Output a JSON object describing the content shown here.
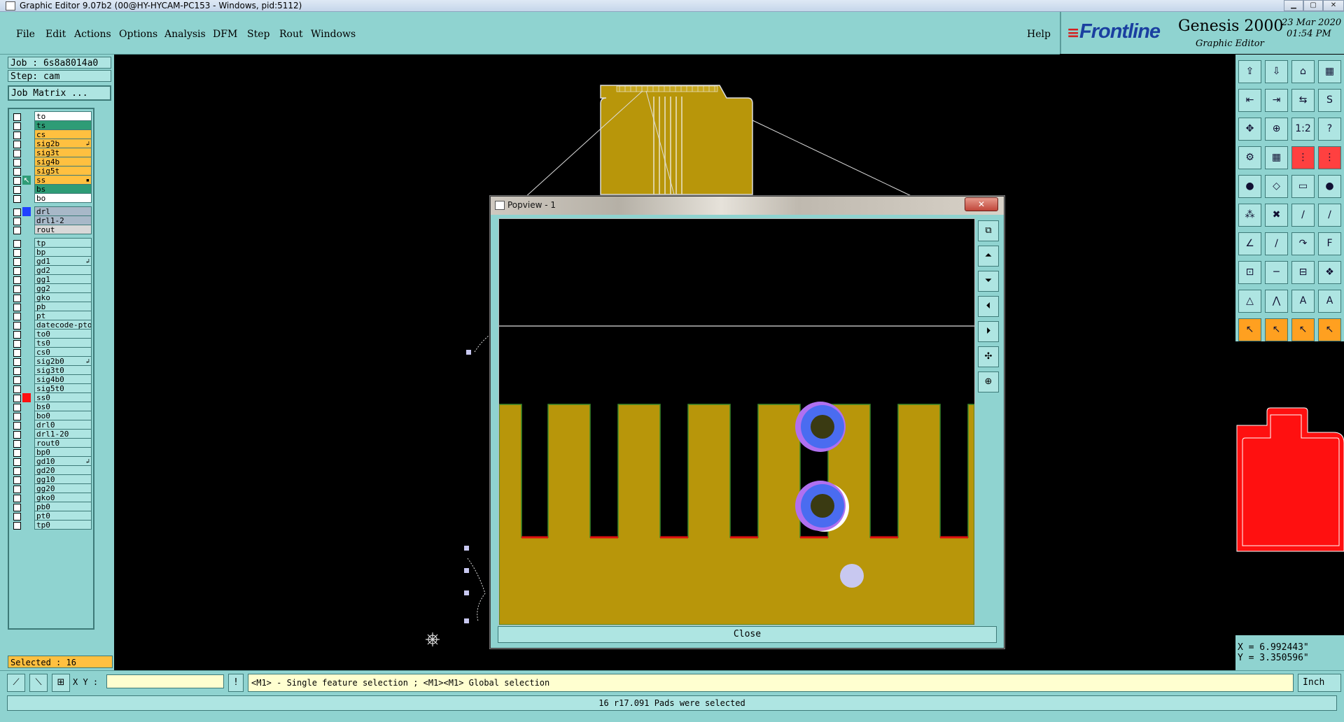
{
  "window": {
    "title": "Graphic Editor 9.07b2 (00@HY-HYCAM-PC153 - Windows, pid:5112)"
  },
  "menu": {
    "items": [
      "File",
      "Edit",
      "Actions",
      "Options",
      "Analysis",
      "DFM",
      "Step",
      "Rout",
      "Windows"
    ],
    "help": "Help"
  },
  "brand": {
    "logo": "Frontline",
    "product": "Genesis 2000",
    "subtitle": "Graphic Editor",
    "date": "23 Mar 2020",
    "time": "01:54 PM"
  },
  "job": {
    "job_label": "Job : 6s8a8014a0",
    "step_label": "Step: cam",
    "matrix_button": "Job Matrix ..."
  },
  "layers": [
    {
      "name": "to",
      "color": "#ffffff",
      "mark": "",
      "ext": ""
    },
    {
      "name": "ts",
      "color": "#2e9c76",
      "mark": "",
      "ext": ""
    },
    {
      "name": "cs",
      "color": "#ffc040",
      "mark": "",
      "ext": ""
    },
    {
      "name": "sig2b",
      "color": "#ffc040",
      "mark": "",
      "ext": "↲"
    },
    {
      "name": "sig3t",
      "color": "#ffc040",
      "mark": "",
      "ext": ""
    },
    {
      "name": "sig4b",
      "color": "#ffc040",
      "mark": "",
      "ext": ""
    },
    {
      "name": "sig5t",
      "color": "#ffc040",
      "mark": "",
      "ext": ""
    },
    {
      "name": "ss",
      "color": "#ffc040",
      "mark": "arrow",
      "ext": "▪"
    },
    {
      "name": "bs",
      "color": "#2e9c76",
      "mark": "",
      "ext": ""
    },
    {
      "name": "bo",
      "color": "#ffffff",
      "mark": "",
      "ext": ""
    },
    {
      "name": "drl",
      "color": "#a8b8c8",
      "mark": "blue",
      "ext": ""
    },
    {
      "name": "drl1-2",
      "color": "#a8b8c8",
      "mark": "",
      "ext": ""
    },
    {
      "name": "rout",
      "color": "#d8d8d8",
      "mark": "",
      "ext": ""
    },
    {
      "name": "tp",
      "color": "#aee5e2",
      "mark": "",
      "ext": ""
    },
    {
      "name": "bp",
      "color": "#aee5e2",
      "mark": "",
      "ext": ""
    },
    {
      "name": "gd1",
      "color": "#aee5e2",
      "mark": "",
      "ext": "↲"
    },
    {
      "name": "gd2",
      "color": "#aee5e2",
      "mark": "",
      "ext": ""
    },
    {
      "name": "gg1",
      "color": "#aee5e2",
      "mark": "",
      "ext": ""
    },
    {
      "name": "gg2",
      "color": "#aee5e2",
      "mark": "",
      "ext": ""
    },
    {
      "name": "gko",
      "color": "#aee5e2",
      "mark": "",
      "ext": ""
    },
    {
      "name": "pb",
      "color": "#aee5e2",
      "mark": "",
      "ext": ""
    },
    {
      "name": "pt",
      "color": "#aee5e2",
      "mark": "",
      "ext": ""
    },
    {
      "name": "datecode-pto",
      "color": "#aee5e2",
      "mark": "",
      "ext": ""
    },
    {
      "name": "to0",
      "color": "#aee5e2",
      "mark": "",
      "ext": ""
    },
    {
      "name": "ts0",
      "color": "#aee5e2",
      "mark": "",
      "ext": ""
    },
    {
      "name": "cs0",
      "color": "#aee5e2",
      "mark": "",
      "ext": ""
    },
    {
      "name": "sig2b0",
      "color": "#aee5e2",
      "mark": "",
      "ext": "↲"
    },
    {
      "name": "sig3t0",
      "color": "#aee5e2",
      "mark": "",
      "ext": ""
    },
    {
      "name": "sig4b0",
      "color": "#aee5e2",
      "mark": "",
      "ext": ""
    },
    {
      "name": "sig5t0",
      "color": "#aee5e2",
      "mark": "",
      "ext": ""
    },
    {
      "name": "ss0",
      "color": "#aee5e2",
      "mark": "red",
      "ext": ""
    },
    {
      "name": "bs0",
      "color": "#aee5e2",
      "mark": "",
      "ext": ""
    },
    {
      "name": "bo0",
      "color": "#aee5e2",
      "mark": "",
      "ext": ""
    },
    {
      "name": "drl0",
      "color": "#aee5e2",
      "mark": "",
      "ext": ""
    },
    {
      "name": "drl1-20",
      "color": "#aee5e2",
      "mark": "",
      "ext": ""
    },
    {
      "name": "rout0",
      "color": "#aee5e2",
      "mark": "",
      "ext": ""
    },
    {
      "name": "bp0",
      "color": "#aee5e2",
      "mark": "",
      "ext": ""
    },
    {
      "name": "gd10",
      "color": "#aee5e2",
      "mark": "",
      "ext": "↲"
    },
    {
      "name": "gd20",
      "color": "#aee5e2",
      "mark": "",
      "ext": ""
    },
    {
      "name": "gg10",
      "color": "#aee5e2",
      "mark": "",
      "ext": ""
    },
    {
      "name": "gg20",
      "color": "#aee5e2",
      "mark": "",
      "ext": ""
    },
    {
      "name": "gko0",
      "color": "#aee5e2",
      "mark": "",
      "ext": ""
    },
    {
      "name": "pb0",
      "color": "#aee5e2",
      "mark": "",
      "ext": ""
    },
    {
      "name": "pt0",
      "color": "#aee5e2",
      "mark": "",
      "ext": ""
    },
    {
      "name": "tp0",
      "color": "#aee5e2",
      "mark": "",
      "ext": ""
    }
  ],
  "selected": "Selected : 16",
  "popview": {
    "title": "Popview - 1",
    "close_label": "Close"
  },
  "coords": {
    "x": "X = 6.992443\"",
    "y": "Y = 3.350596\""
  },
  "bottom": {
    "xy_label": "X Y :",
    "xy_value": "",
    "hint": "<M1> - Single feature selection ; <M1><M1> Global selection",
    "units": "Inch"
  },
  "status": "16 r17.091 Pads were selected",
  "colors": {
    "panel": "#8fd3d0",
    "copper": "#b8960a",
    "highlight": "#4a6cf0",
    "selected_bg": "#ffc040"
  }
}
